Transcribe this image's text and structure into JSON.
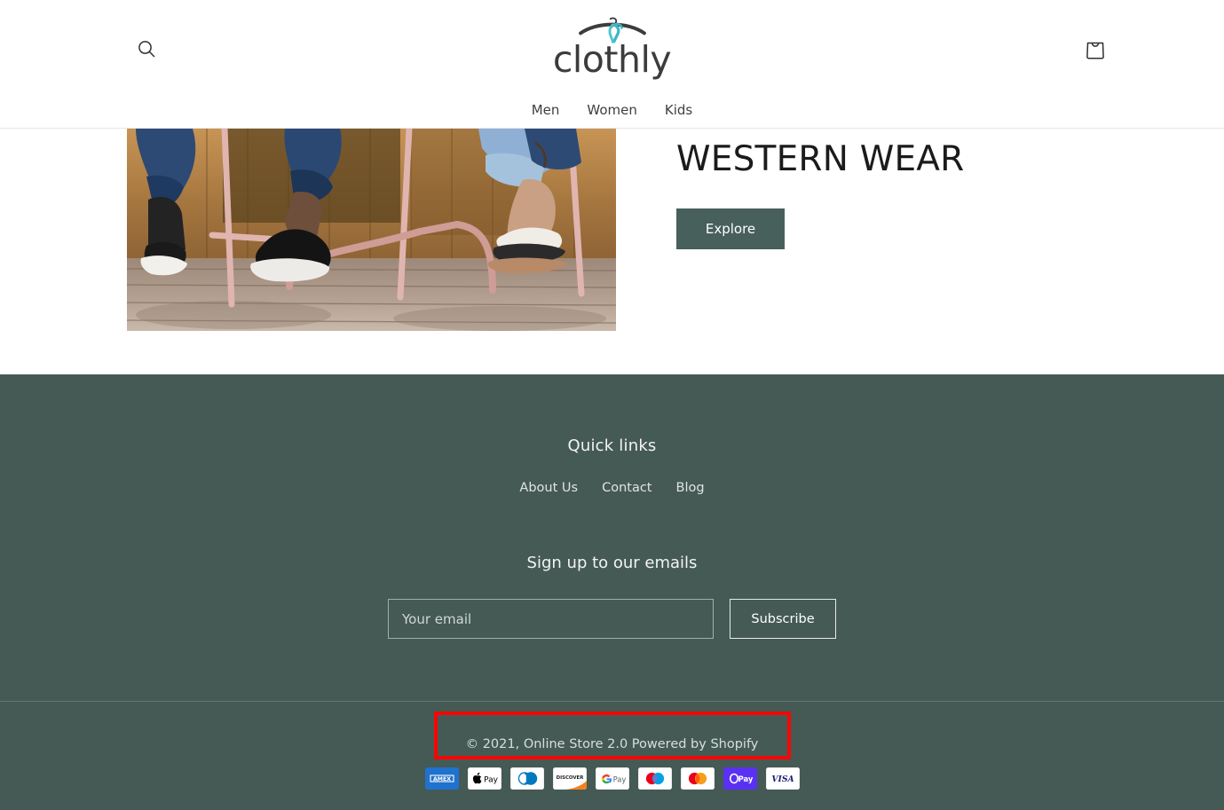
{
  "header": {
    "logo_text": "clothly",
    "logo_icon": "clothes-hanger-icon",
    "search_icon": "search-icon",
    "cart_icon": "shopping-bag-icon",
    "nav": [
      {
        "label": "Men"
      },
      {
        "label": "Women"
      },
      {
        "label": "Kids"
      }
    ]
  },
  "hero": {
    "title": "WESTERN WEAR",
    "button_label": "Explore",
    "image_alt": "Two people seated at an outdoor table on a wooden deck, legs and shoes visible"
  },
  "footer": {
    "quick_links_title": "Quick links",
    "quick_links": [
      {
        "label": "About Us"
      },
      {
        "label": "Contact"
      },
      {
        "label": "Blog"
      }
    ],
    "signup_title": "Sign up to our emails",
    "email_placeholder": "Your email",
    "email_value": "",
    "subscribe_label": "Subscribe",
    "copyright": "© 2021, Online Store 2.0 Powered by Shopify",
    "payment_methods": [
      {
        "name": "American Express",
        "icon": "amex-icon"
      },
      {
        "name": "Apple Pay",
        "icon": "apple-pay-icon"
      },
      {
        "name": "Diners Club",
        "icon": "diners-club-icon"
      },
      {
        "name": "Discover",
        "icon": "discover-icon"
      },
      {
        "name": "Google Pay",
        "icon": "google-pay-icon"
      },
      {
        "name": "Maestro",
        "icon": "maestro-icon"
      },
      {
        "name": "Mastercard",
        "icon": "mastercard-icon"
      },
      {
        "name": "Shop Pay",
        "icon": "shop-pay-icon"
      },
      {
        "name": "Visa",
        "icon": "visa-icon"
      }
    ]
  },
  "annotation": {
    "highlight_color": "#fb0404",
    "highlight_target": "copyright"
  },
  "colors": {
    "footer_bg": "#455a55",
    "button_bg": "#48605b",
    "logo_teal": "#3fb6c0",
    "logo_gray": "#3c3c3c"
  }
}
